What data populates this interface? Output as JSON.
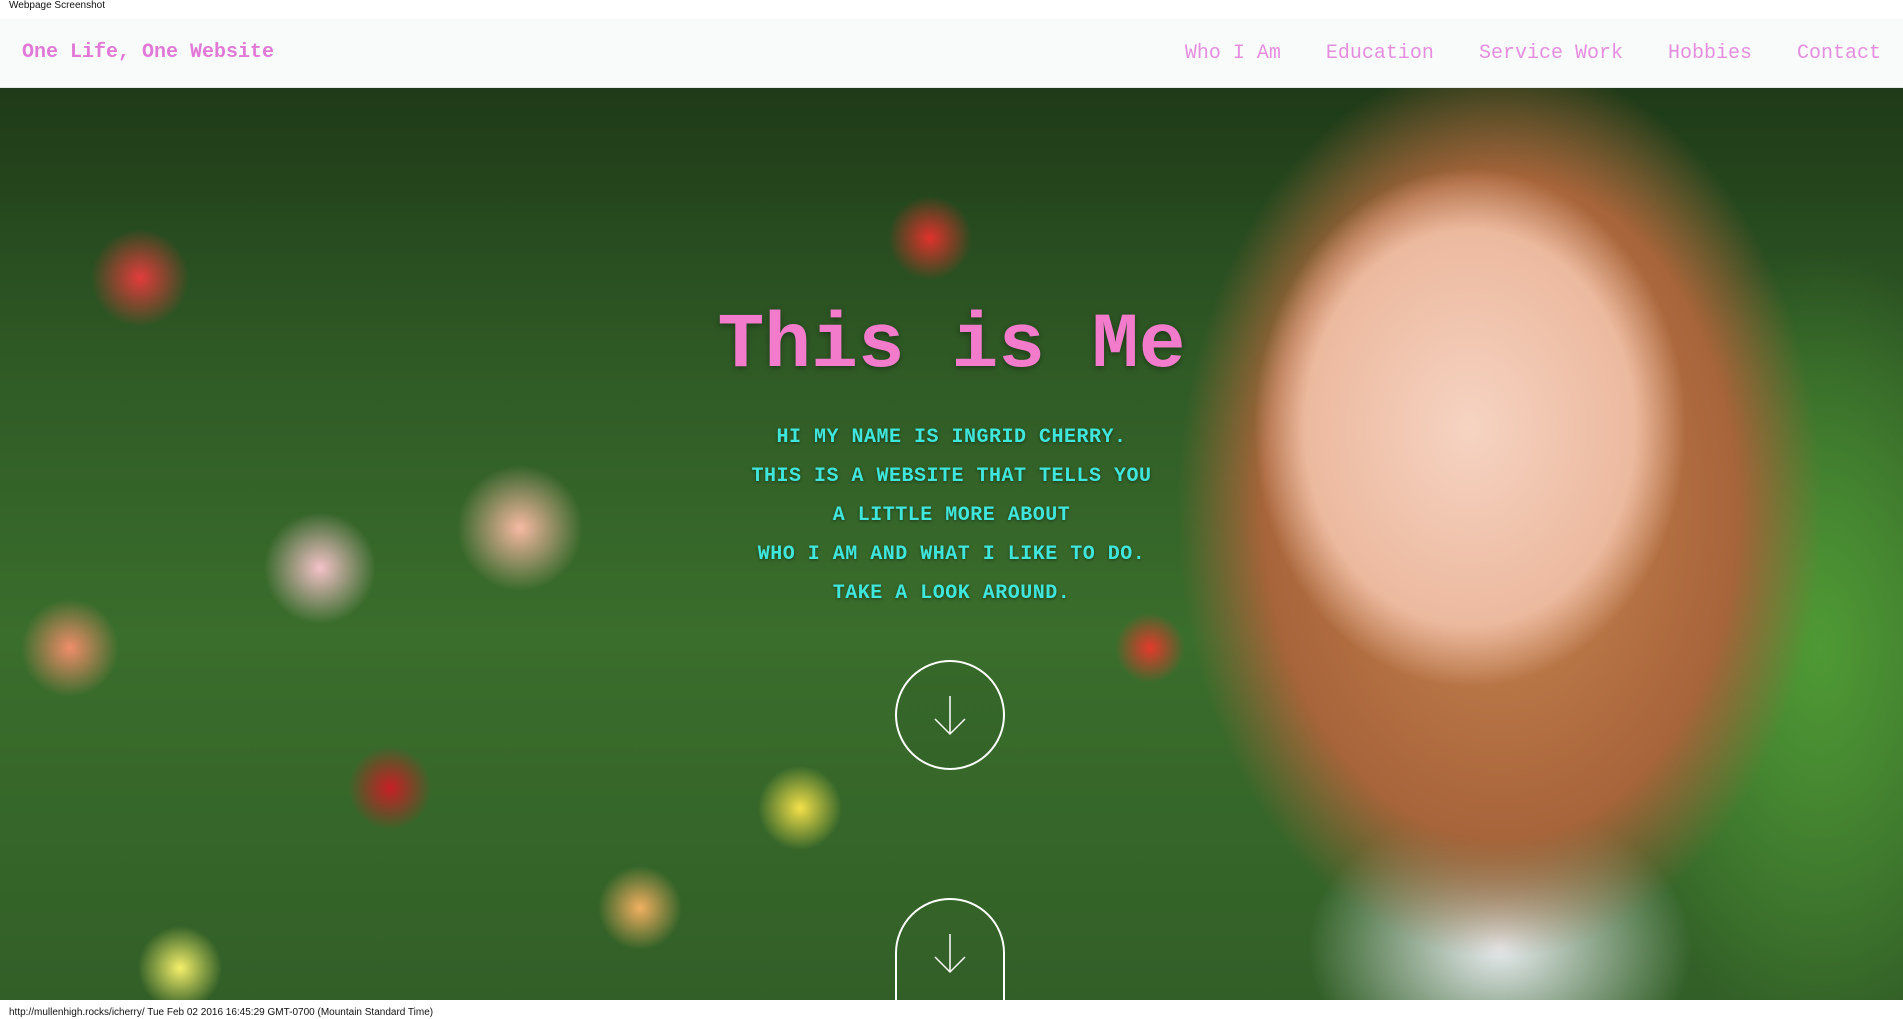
{
  "capture_label": "Webpage Screenshot",
  "header": {
    "brand": "One Life, One Website",
    "nav": [
      {
        "label": "Who I Am"
      },
      {
        "label": "Education"
      },
      {
        "label": "Service Work"
      },
      {
        "label": "Hobbies"
      },
      {
        "label": "Contact"
      }
    ]
  },
  "hero": {
    "title": "This is Me",
    "intro_lines": [
      "HI MY NAME IS INGRID CHERRY.",
      "THIS IS A WEBSITE THAT TELLS YOU",
      "A LITTLE MORE ABOUT",
      "WHO I AM AND WHAT I LIKE TO DO.",
      "TAKE A LOOK AROUND."
    ],
    "scroll_icon": "arrow-down-icon"
  },
  "status_bar": {
    "text": "http://mullenhigh.rocks/icherry/ Tue Feb 02 2016 16:45:29 GMT-0700 (Mountain Standard Time)"
  },
  "colors": {
    "brand": "#e07ad6",
    "nav_link": "#e58ee0",
    "title": "#f27ccb",
    "intro_text": "#3fe6dc",
    "navbar_bg": "#f9fbfa"
  }
}
